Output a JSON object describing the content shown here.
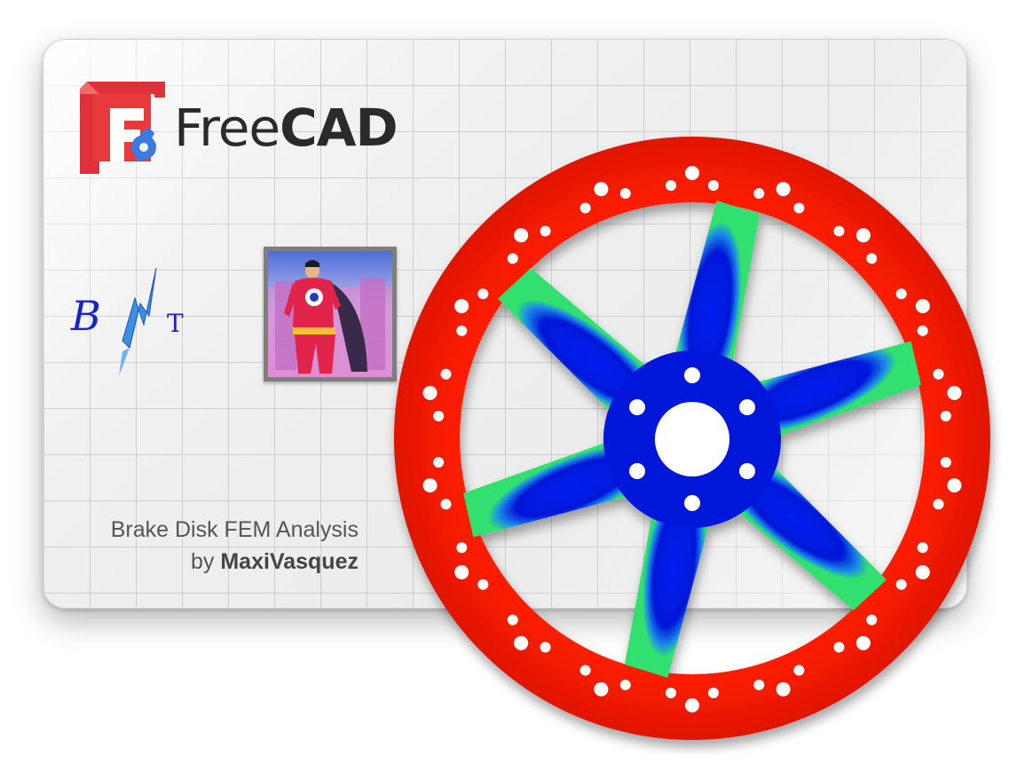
{
  "card": {
    "brand": {
      "prefix": "Free",
      "suffix": "CAD"
    },
    "bnt_logo": {
      "text": "BNT"
    },
    "caption": {
      "line1": "Brake Disk FEM Analysis",
      "by": "by ",
      "author": "MaxiVasquez"
    }
  },
  "colors": {
    "logo_red": "#e0313a",
    "logo_blue": "#3b7be0",
    "disk_high_stress": "#ff1f00",
    "disk_low_stress": "#0018d8",
    "disk_mid": "#30e070"
  },
  "icons": [
    "freecad-logo-icon",
    "bnt-logo-icon",
    "superhero-avatar-image",
    "brake-disk-fem-image"
  ]
}
